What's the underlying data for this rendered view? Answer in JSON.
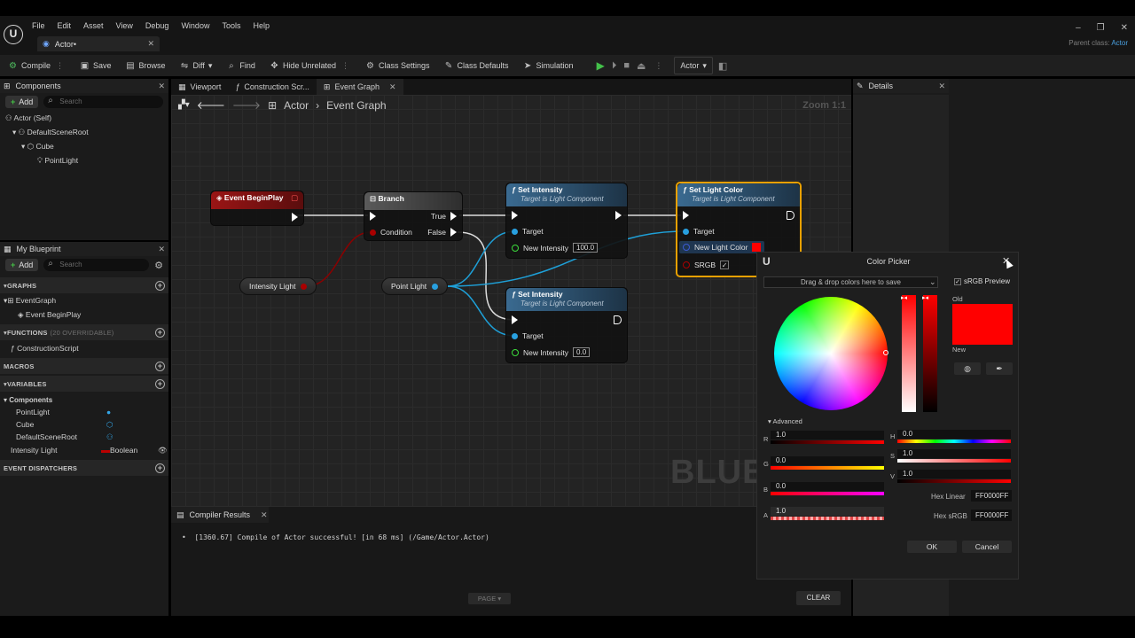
{
  "menu": [
    "File",
    "Edit",
    "Asset",
    "View",
    "Debug",
    "Window",
    "Tools",
    "Help"
  ],
  "doc_tab": "Actor•",
  "parent_class_label": "Parent class:",
  "parent_class_value": "Actor",
  "toolbar": {
    "compile": "Compile",
    "save": "Save",
    "browse": "Browse",
    "diff": "Diff",
    "find": "Find",
    "hide_unrelated": "Hide Unrelated",
    "class_settings": "Class Settings",
    "class_defaults": "Class Defaults",
    "simulation": "Simulation",
    "actor_select": "Actor"
  },
  "components_panel": {
    "title": "Components",
    "add": "Add",
    "search_placeholder": "Search",
    "tree": [
      "Actor (Self)",
      "DefaultSceneRoot",
      "Cube",
      "PointLight"
    ]
  },
  "my_blueprint": {
    "title": "My Blueprint",
    "add": "Add",
    "search_placeholder": "Search",
    "graphs_header": "GRAPHS",
    "graphs": [
      "EventGraph",
      "Event BeginPlay"
    ],
    "functions_header": "FUNCTIONS",
    "functions_sub": "(20 OVERRIDABLE)",
    "functions": [
      "ConstructionScript"
    ],
    "macros_header": "MACROS",
    "variables_header": "VARIABLES",
    "components_group": "Components",
    "component_vars": [
      "PointLight",
      "Cube",
      "DefaultSceneRoot"
    ],
    "var_name": "Intensity Light",
    "var_type": "Boolean",
    "dispatchers_header": "EVENT DISPATCHERS"
  },
  "editor_tabs": [
    "Viewport",
    "Construction Scr...",
    "Event Graph"
  ],
  "breadcrumb": {
    "root": "Actor",
    "graph": "Event Graph"
  },
  "zoom_label": "Zoom 1:1",
  "watermark": "BLUEI",
  "nodes": {
    "begin_play": "Event BeginPlay",
    "branch": "Branch",
    "branch_true": "True",
    "branch_false": "False",
    "branch_condition": "Condition",
    "set_intensity_1": {
      "title": "Set Intensity",
      "sub": "Target is Light Component",
      "target": "Target",
      "value_label": "New Intensity",
      "value": "100.0"
    },
    "set_intensity_2": {
      "title": "Set Intensity",
      "sub": "Target is Light Component",
      "target": "Target",
      "value_label": "New Intensity",
      "value": "0.0"
    },
    "set_light_color": {
      "title": "Set Light Color",
      "sub": "Target is Light Component",
      "target": "Target",
      "color_label": "New Light Color",
      "srgb": "SRGB"
    },
    "intensity_var": "Intensity Light",
    "point_light_var": "Point Light"
  },
  "compiler": {
    "title": "Compiler Results",
    "message": "[1360.67] Compile of Actor successful! [in 68 ms] (/Game/Actor.Actor)",
    "page": "PAGE",
    "clear": "CLEAR"
  },
  "details": {
    "title": "Details"
  },
  "color_picker": {
    "title": "Color Picker",
    "drop_hint": "Drag & drop colors here to save",
    "srgb_preview": "sRGB Preview",
    "old": "Old",
    "new": "New",
    "advanced": "Advanced",
    "r": "1.0",
    "g": "0.0",
    "b": "0.0",
    "a": "1.0",
    "h": "0.0",
    "s": "1.0",
    "v": "1.0",
    "hex_linear_label": "Hex Linear",
    "hex_linear": "FF0000FF",
    "hex_srgb_label": "Hex sRGB",
    "hex_srgb": "FF0000FF",
    "ok": "OK",
    "cancel": "Cancel",
    "selected_color": "#ff0000"
  }
}
